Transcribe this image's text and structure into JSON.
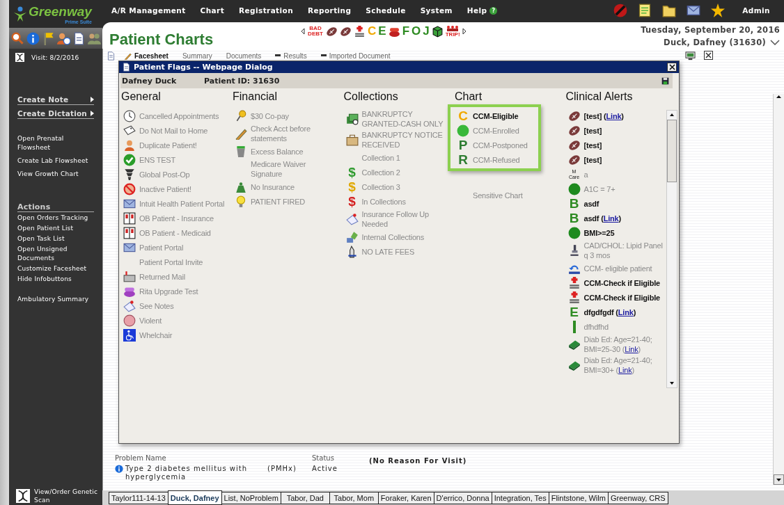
{
  "logo": {
    "name": "Greenway",
    "tagline": "Prime Suite"
  },
  "menu": [
    {
      "label": "A/R Management"
    },
    {
      "label": "Chart"
    },
    {
      "label": "Registration"
    },
    {
      "label": "Reporting"
    },
    {
      "label": "Schedule"
    },
    {
      "label": "System"
    },
    {
      "label": "Help",
      "badge": "?"
    }
  ],
  "user": "Admin",
  "page_title": "Patient Charts",
  "toolbar": [
    {
      "kind": "baddebt",
      "glyph": "BAD DEBT"
    },
    {
      "kind": "football"
    },
    {
      "kind": "football"
    },
    {
      "kind": "medicare"
    },
    {
      "kind": "letter",
      "glyph": "C",
      "color": "#f0a800"
    },
    {
      "kind": "letter",
      "glyph": "E",
      "color": "#2e8b22"
    },
    {
      "kind": "telephone"
    },
    {
      "kind": "letter",
      "glyph": "F",
      "color": "#2e8b22"
    },
    {
      "kind": "letter",
      "glyph": "O",
      "color": "#2e8b22"
    },
    {
      "kind": "letter",
      "glyph": "J",
      "color": "#2e8b22"
    },
    {
      "kind": "cube"
    },
    {
      "kind": "trip",
      "glyph": "TRIP!"
    }
  ],
  "date": "Tuesday, September 20, 2016",
  "patient": "Duck, Dafney (31630)",
  "sidebar": {
    "visit": "Visit: 8/2/2016",
    "menus": [
      {
        "label": "Create Note"
      },
      {
        "label": "Create Dictation"
      }
    ],
    "links": [
      "Open Prenatal Flowsheet",
      "Create Lab Flowsheet",
      "View Growth Chart"
    ],
    "actions_heading": "Actions",
    "actions": [
      "Open Orders Tracking",
      "Open Patient List",
      "Open Task List",
      "Open Unsigned Documents",
      "Customize Facesheet",
      "Hide Infobuttons"
    ],
    "extra": [
      "Ambulatory Summary"
    ],
    "footer": "View/Order Genetic Scan"
  },
  "content_tabs": [
    {
      "label": "Facesheet",
      "selected": true
    },
    {
      "label": "Summary",
      "selected": false
    },
    {
      "label": "Documents",
      "selected": false
    },
    {
      "label": "Results",
      "selected": false
    },
    {
      "label": "Imported Document",
      "selected": false
    }
  ],
  "dialog": {
    "title": "Patient Flags -- Webpage Dialog",
    "patient_name": "Dafney Duck",
    "patient_id": "Patient ID: 31630",
    "columns": [
      {
        "heading": "General",
        "items": [
          {
            "label": "Cancelled Appointments",
            "active": false,
            "kind": "clock"
          },
          {
            "label": "Do Not Mail to Home",
            "active": false,
            "kind": "tag"
          },
          {
            "label": "Duplicate Patient!",
            "active": false,
            "kind": "person"
          },
          {
            "label": "ENS TEST",
            "active": false,
            "kind": "check"
          },
          {
            "label": "Global Post-Op",
            "active": false,
            "kind": "tornado"
          },
          {
            "label": "Inactive Patient!",
            "active": false,
            "kind": "nosign"
          },
          {
            "label": "Intuit Health Patient Portal",
            "active": false,
            "kind": "envelope"
          },
          {
            "label": "OB Patient - Insurance",
            "active": false,
            "kind": "booklet"
          },
          {
            "label": "OB Patient - Medicaid",
            "active": false,
            "kind": "booklet"
          },
          {
            "label": "Patient Portal",
            "active": false,
            "kind": "envelope"
          },
          {
            "label": "Patient Portal Invite",
            "active": false
          },
          {
            "label": "Returned Mail",
            "active": false,
            "kind": "mailbox"
          },
          {
            "label": "Rita Upgrade Test",
            "active": false,
            "kind": "phone"
          },
          {
            "label": "See Notes",
            "active": false,
            "kind": "note"
          },
          {
            "label": "Violent",
            "active": false,
            "kind": "sphere"
          },
          {
            "label": "Whelchair",
            "active": false,
            "kind": "wheelchair"
          }
        ]
      },
      {
        "heading": "Financial",
        "items": [
          {
            "label": "$30 Co-pay",
            "active": false,
            "kind": "pin"
          },
          {
            "label": "Check Acct before statements",
            "active": false,
            "kind": "pencil"
          },
          {
            "label": "Excess Balance",
            "active": false,
            "kind": "bin"
          },
          {
            "label": "Medicare Waiver Signature",
            "active": false
          },
          {
            "label": "No Insurance",
            "active": false,
            "kind": "moneybag"
          },
          {
            "label": "PATIENT FIRED",
            "active": false,
            "kind": "bulb"
          }
        ]
      },
      {
        "heading": "Collections",
        "items": [
          {
            "label": "BANKRUPTCY GRANTED-CASH ONLY",
            "active": false,
            "kind": "cash"
          },
          {
            "label": "BANKRUPTCY NOTICE RECEIVED",
            "active": false,
            "kind": "box"
          },
          {
            "label": "Collection 1",
            "active": false
          },
          {
            "label": "Collection 2",
            "active": false,
            "kind": "dollar",
            "glyph": "$",
            "color": "#2e9a2e"
          },
          {
            "label": "Collection 3",
            "active": false,
            "kind": "dollar",
            "glyph": "$",
            "color": "#e0a800"
          },
          {
            "label": "In Collections",
            "active": false,
            "kind": "dollar",
            "glyph": "$",
            "color": "#d42020"
          },
          {
            "label": "Insurance Follow Up Needed",
            "active": false,
            "kind": "note"
          },
          {
            "label": "Internal Collections",
            "active": false,
            "kind": "moneyhand"
          },
          {
            "label": "NO LATE FEES",
            "active": false,
            "kind": "hand"
          }
        ]
      },
      {
        "heading": "Chart",
        "items": [
          {
            "label": "CCM-Eligible",
            "active": true,
            "highlighted": true,
            "kind": "letter",
            "glyph": "C",
            "color": "#f0a800"
          },
          {
            "label": "CCM-Enrolled",
            "active": false,
            "highlighted": true,
            "kind": "dot",
            "color": "#3ab83a"
          },
          {
            "label": "CCM-Postponed",
            "active": false,
            "highlighted": true,
            "kind": "letter",
            "glyph": "P",
            "color": "#2e7d32"
          },
          {
            "label": "CCM-Refused",
            "active": false,
            "highlighted": true,
            "kind": "letter",
            "glyph": "R",
            "color": "#2e7d32"
          },
          {
            "label": "Sensitive Chart",
            "active": false,
            "highlighted": false
          }
        ]
      },
      {
        "heading": "Clinical Alerts",
        "items": [
          {
            "label": "[test] (",
            "link": "Link",
            "after": ")",
            "active": true,
            "kind": "football"
          },
          {
            "label": "[test]",
            "active": true,
            "kind": "football"
          },
          {
            "label": "[test]",
            "active": true,
            "kind": "football"
          },
          {
            "label": "[test]",
            "active": true,
            "kind": "football"
          },
          {
            "label": "a",
            "active": false,
            "kind": "mcare",
            "glyph": "M Care"
          },
          {
            "label": "A1C = 7+",
            "active": false,
            "kind": "dot",
            "color": "#1e8a1e"
          },
          {
            "label": "asdf",
            "active": true,
            "kind": "letter",
            "glyph": "B",
            "color": "#2e8b22"
          },
          {
            "label": "asdf (",
            "link": "Link",
            "after": ")",
            "active": true,
            "kind": "letter",
            "glyph": "B",
            "color": "#2e8b22"
          },
          {
            "label": "BMI>=25",
            "active": true,
            "kind": "dot",
            "color": "#1e8a1e"
          },
          {
            "label": "CAD/CHOL: Lipid Panel q 3 mos",
            "active": false,
            "kind": "lab"
          },
          {
            "label": "CCM- eligible patient",
            "active": false,
            "kind": "referral"
          },
          {
            "label": "CCM-Check if Eligible",
            "active": true,
            "kind": "medicare"
          },
          {
            "label": "CCM-Check if Eligible",
            "active": true,
            "kind": "medicare"
          },
          {
            "label": "dfgdfgdf (",
            "link": "Link",
            "after": ")",
            "active": true,
            "kind": "letter",
            "glyph": "E",
            "color": "#2e8b22"
          },
          {
            "label": "dfhdfhd",
            "active": false,
            "kind": "bar"
          },
          {
            "label": "Diab Ed: Age=21-40; BMI=25-30 (",
            "link": "Link",
            "after": ")",
            "active": false,
            "kind": "book"
          },
          {
            "label": "Diab Ed: Age=21-40; BMI=30+ (",
            "link": "Link",
            "after": ")",
            "active": false,
            "kind": "book"
          }
        ]
      }
    ]
  },
  "problems": {
    "columns": [
      "Problem Name",
      "Status"
    ],
    "rows": [
      {
        "name": "Type 2 diabetes mellitus with hyperglycemia",
        "source": "(PMHx)",
        "status": "Active"
      }
    ],
    "visit_reason": "(No Reason For Visit)"
  },
  "patient_tabs": [
    {
      "label": "Taylor111-14-13",
      "selected": false
    },
    {
      "label": "Duck, Dafney",
      "selected": true
    },
    {
      "label": "List, NoProblem",
      "selected": false
    },
    {
      "label": "Tabor, Dad",
      "selected": false
    },
    {
      "label": "Tabor, Mom",
      "selected": false
    },
    {
      "label": "Foraker, Karen",
      "selected": false
    },
    {
      "label": "D'errico, Donna",
      "selected": false
    },
    {
      "label": "Integration, Tes",
      "selected": false
    },
    {
      "label": "Flintstone, Wilm",
      "selected": false
    },
    {
      "label": "Greenway, CRS",
      "selected": false
    }
  ]
}
